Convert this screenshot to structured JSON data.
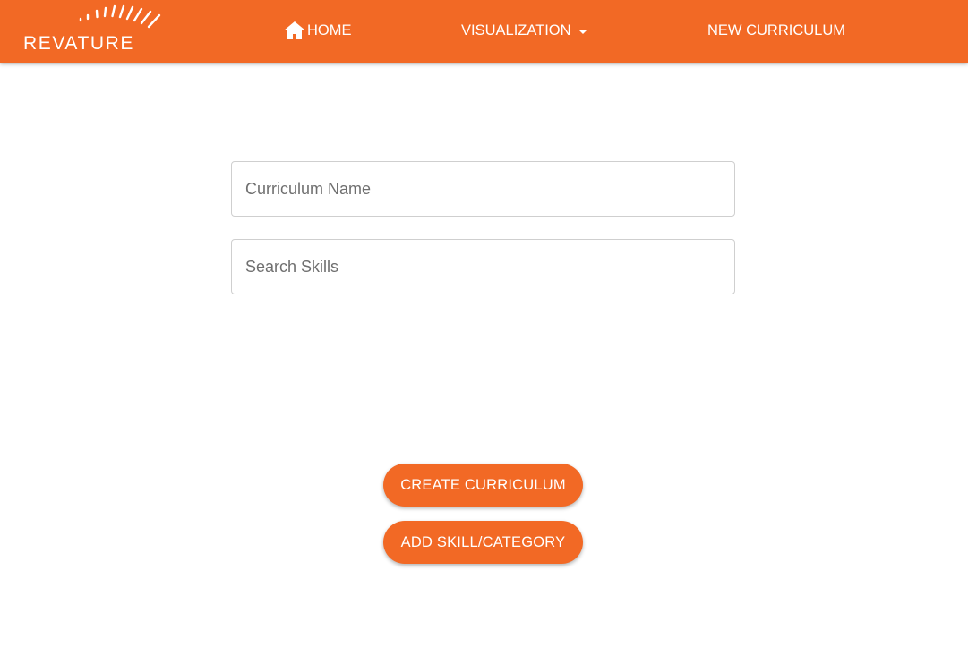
{
  "brand": {
    "logo_text": "REVATURE",
    "color": "#f26925"
  },
  "nav": {
    "home_label": "HOME",
    "visualization_label": "VISUALIZATION",
    "new_curriculum_label": "NEW CURRICULUM"
  },
  "form": {
    "curriculum_name_placeholder": "Curriculum Name",
    "curriculum_name_value": "",
    "search_skills_placeholder": "Search Skills",
    "search_skills_value": ""
  },
  "actions": {
    "create_label": "CREATE CURRICULUM",
    "add_label": "ADD SKILL/CATEGORY"
  },
  "icons": {
    "home": "home-icon",
    "dropdown": "caret-down-icon"
  }
}
